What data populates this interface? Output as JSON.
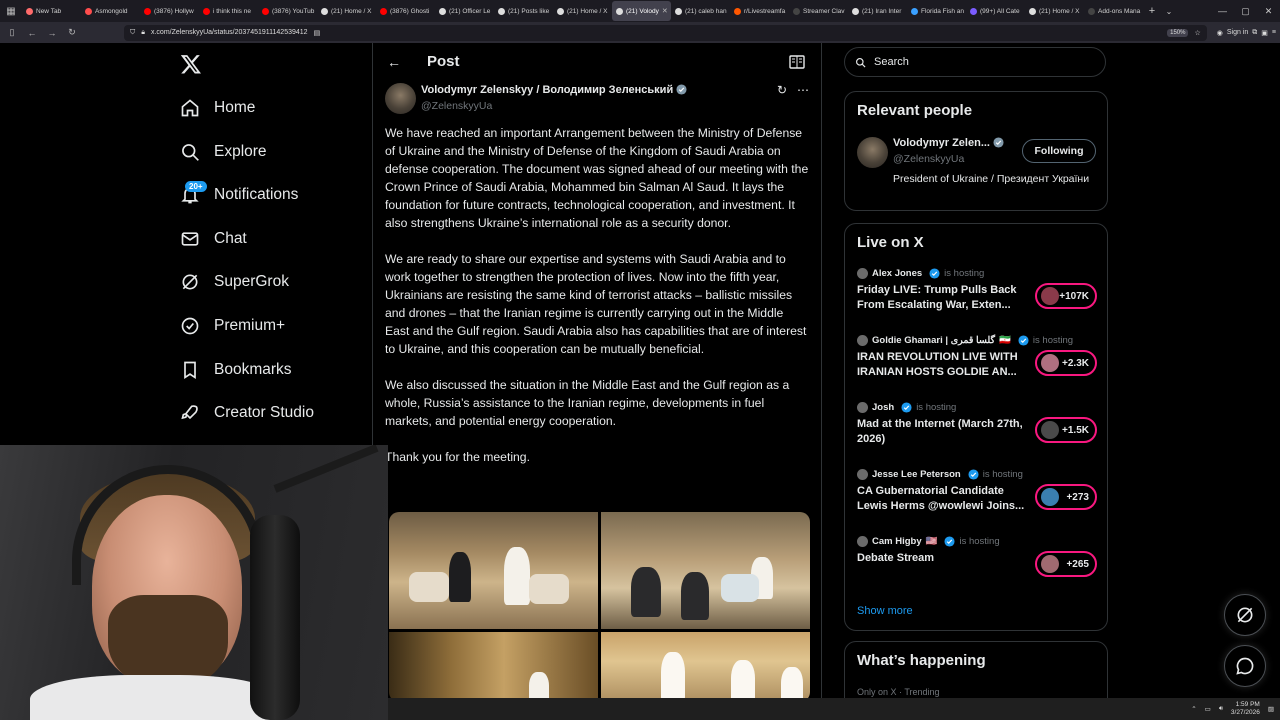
{
  "browser": {
    "tabs": [
      {
        "label": "New Tab",
        "color": "#ff6b6b",
        "active": false
      },
      {
        "label": "Asmongold",
        "color": "#ff4d4d",
        "active": false
      },
      {
        "label": "(3876) Hollyw",
        "color": "#ff0000",
        "active": false
      },
      {
        "label": "i think this ne",
        "color": "#ff0000",
        "active": false
      },
      {
        "label": "(3876) YouTub",
        "color": "#ff0000",
        "active": false
      },
      {
        "label": "(21) Home / X",
        "color": "#dddddd",
        "active": false
      },
      {
        "label": "(3876) Ghosti",
        "color": "#ff0000",
        "active": false
      },
      {
        "label": "(21) Officer Le",
        "color": "#dddddd",
        "active": false
      },
      {
        "label": "(21) Posts like",
        "color": "#dddddd",
        "active": false
      },
      {
        "label": "(21) Home / X",
        "color": "#dddddd",
        "active": false
      },
      {
        "label": "(21) Volody",
        "color": "#dddddd",
        "active": true
      },
      {
        "label": "(21) caleb han",
        "color": "#dddddd",
        "active": false
      },
      {
        "label": "r/Livestreamfa",
        "color": "#ff5700",
        "active": false
      },
      {
        "label": "Streamer Clav",
        "color": "#444444",
        "active": false
      },
      {
        "label": "(21) Iran Inter",
        "color": "#dddddd",
        "active": false
      },
      {
        "label": "Florida Fish an",
        "color": "#3aa0ff",
        "active": false
      },
      {
        "label": "(99+) All Cate",
        "color": "#7b5cff",
        "active": false
      },
      {
        "label": "(21) Home / X",
        "color": "#dddddd",
        "active": false
      },
      {
        "label": "Add-ons Mana",
        "color": "#444444",
        "active": false
      }
    ],
    "url": "x.com/ZelenskyyUa/status/2037451911142539412",
    "zoom": "150%",
    "sign_in": "Sign in"
  },
  "sidebar": {
    "items": [
      {
        "label": "Home",
        "icon": "home-icon"
      },
      {
        "label": "Explore",
        "icon": "search-icon"
      },
      {
        "label": "Notifications",
        "icon": "bell-icon",
        "badge": "20+"
      },
      {
        "label": "Chat",
        "icon": "mail-icon"
      },
      {
        "label": "SuperGrok",
        "icon": "grok-icon"
      },
      {
        "label": "Premium+",
        "icon": "verified-badge-icon"
      },
      {
        "label": "Bookmarks",
        "icon": "bookmark-icon"
      },
      {
        "label": "Creator Studio",
        "icon": "rocket-icon"
      }
    ]
  },
  "post": {
    "header_title": "Post",
    "author_name": "Volodymyr Zelenskyy / Володимир Зеленський",
    "author_handle": "@ZelenskyyUa",
    "paragraphs": [
      "We have reached an important Arrangement between the Ministry of Defense of Ukraine and the Ministry of Defense of the Kingdom of Saudi Arabia on defense cooperation. The document was signed ahead of our meeting with the Crown Prince of Saudi Arabia, Mohammed bin Salman Al Saud. It lays the foundation for future contracts, technological cooperation, and investment. It also strengthens Ukraine’s international role as a security donor.",
      "We are ready to share our expertise and systems with Saudi Arabia and to work together to strengthen the protection of lives. Now into the fifth year, Ukrainians are resisting the same kind of terrorist attacks – ballistic missiles and drones – that the Iranian regime is currently carrying out in the Middle East and the Gulf region. Saudi Arabia also has capabilities that are of interest to Ukraine, and this cooperation can be mutually beneficial.",
      "We also discussed the situation in the Middle East and the Gulf region as a whole, Russia’s assistance to the Iranian regime, developments in fuel markets, and potential energy cooperation.",
      "Thank you for the meeting."
    ]
  },
  "search": {
    "placeholder": "Search"
  },
  "relevant_people": {
    "title": "Relevant people",
    "name": "Volodymyr Zelen...",
    "handle": "@ZelenskyyUa",
    "follow_label": "Following",
    "bio": "President of Ukraine / Президент України"
  },
  "live": {
    "title": "Live on X",
    "hosting_label": "is hosting",
    "items": [
      {
        "host": "Alex Jones",
        "title": "Friday LIVE: Trump Pulls Back From Escalating War, Exten...",
        "count": "+107K",
        "flag": ""
      },
      {
        "host": "Goldie Ghamari | گلسا قمری",
        "title": "IRAN REVOLUTION LIVE WITH IRANIAN HOSTS GOLDIE AN...",
        "count": "+2.3K",
        "flag": "🇮🇷"
      },
      {
        "host": "Josh",
        "title": "Mad at the Internet (March 27th, 2026)",
        "count": "+1.5K",
        "flag": ""
      },
      {
        "host": "Jesse Lee Peterson",
        "title": "CA Gubernatorial Candidate Lewis Herms @wowlewi Joins...",
        "count": "+273",
        "flag": ""
      },
      {
        "host": "Cam Higby",
        "title": "Debate Stream",
        "count": "+265",
        "flag": "🇺🇸"
      }
    ],
    "show_more": "Show more"
  },
  "happening": {
    "title": "What’s happening",
    "meta": "Only on X · Trending"
  },
  "taskbar": {
    "time": "1:59 PM",
    "date": "3/27/2026"
  },
  "colors": {
    "accent": "#1d9bf0",
    "live": "#f91880",
    "border": "#2f3336",
    "muted": "#71767b"
  }
}
